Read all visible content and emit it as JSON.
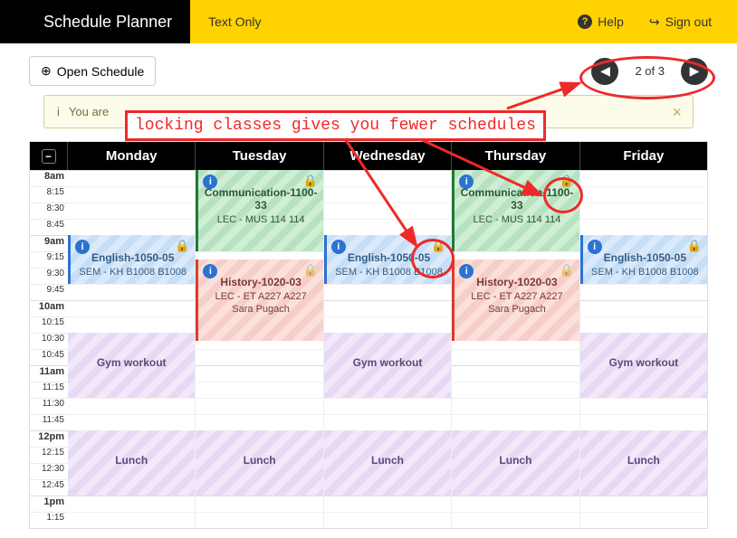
{
  "top": {
    "brand": "Schedule Planner",
    "text_only": "Text Only",
    "help": "Help",
    "signout": "Sign out"
  },
  "toolbar": {
    "open_schedule": "Open Schedule",
    "pager_label": "2 of 3"
  },
  "alert": {
    "prefix": "You are ",
    "annotation": "locking classes gives you fewer schedules"
  },
  "days": [
    "Monday",
    "Tuesday",
    "Wednesday",
    "Thursday",
    "Friday"
  ],
  "time_slots": [
    "8am",
    "8:15",
    "8:30",
    "8:45",
    "9am",
    "9:15",
    "9:30",
    "9:45",
    "10am",
    "10:15",
    "10:30",
    "10:45",
    "11am",
    "11:15",
    "11:30",
    "11:45",
    "12pm",
    "12:15",
    "12:30",
    "12:45",
    "1pm",
    "1:15"
  ],
  "events": {
    "comm": {
      "title": "Communication-1100-33",
      "sub": "LEC - MUS 114 114"
    },
    "eng": {
      "title": "English-1050-05",
      "sub": "SEM - KH B1008 B1008"
    },
    "hist": {
      "title": "History-1020-03",
      "sub1": "LEC - ET A227 A227",
      "sub2": "Sara Pugach"
    },
    "gym": {
      "title": "Gym workout"
    },
    "lunch": {
      "title": "Lunch"
    }
  }
}
